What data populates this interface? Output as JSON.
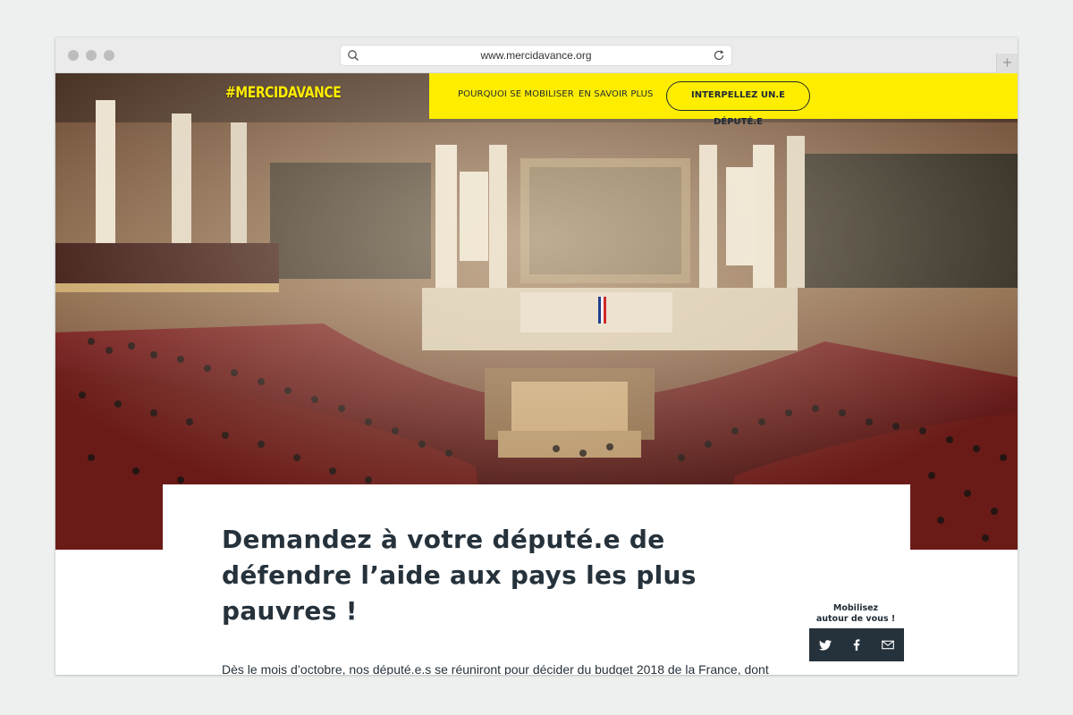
{
  "browser": {
    "url": "www.mercidavance.org",
    "new_tab_glyph": "+"
  },
  "site": {
    "logo": "#MERCIDAVANCE",
    "nav": {
      "link1": "POURQUOI SE MOBILISER",
      "link2": "EN SAVOIR PLUS",
      "cta": "INTERPELLEZ UN.E DÉPUTÉ.E"
    },
    "accent_color": "#ffed00",
    "text_color": "#26323b"
  },
  "article": {
    "headline": "Demandez à votre député.e de défendre l’aide aux pays les plus pauvres !",
    "body": "Dès le mois d’octobre, nos député.e.s se réuniront pour décider du budget 2018 de la France, dont le budget d’aide publique au développement (APD) alloué aux pays les plus pauvres."
  },
  "share": {
    "title_line1": "Mobilisez",
    "title_line2": "autour de vous !",
    "icons": [
      "twitter-icon",
      "facebook-icon",
      "email-icon"
    ]
  },
  "hero_image": {
    "icon": "parliament-hemicycle-photo"
  }
}
